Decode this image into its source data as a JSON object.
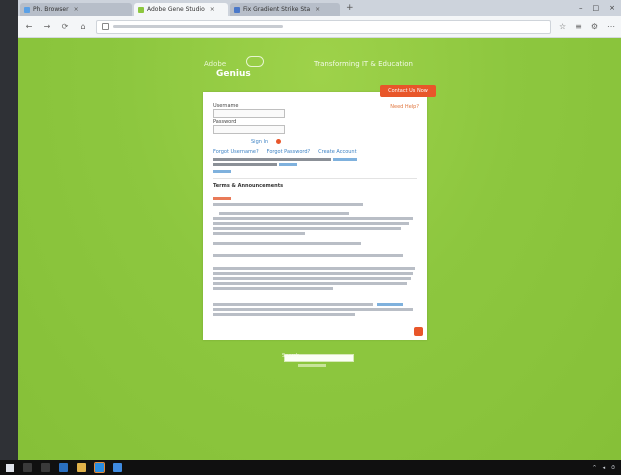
{
  "browser": {
    "tabs": [
      {
        "label": "Ph. Browser",
        "favicon_color": "#5aa0e6"
      },
      {
        "label": "Adobe Gene Studio",
        "favicon_color": "#8dc73f"
      },
      {
        "label": "Fix Gradient Strike Sta",
        "favicon_color": "#4a78c9"
      }
    ],
    "new_tab": "+",
    "window_controls": [
      "–",
      "□",
      "×"
    ],
    "nav": {
      "back": "←",
      "forward": "→",
      "reload": "⟳",
      "home": "⌂"
    },
    "toolbar_icons": [
      "☆",
      "≡",
      "⚙",
      "⋯"
    ]
  },
  "page": {
    "logo_line1": "Adobe",
    "logo_line2": "Genius",
    "tagline": "Transforming IT & Education",
    "card": {
      "report_button": "Contact Us Now",
      "help_link": "Need Help?",
      "username_label": "Username",
      "password_label": "Password",
      "signin_label": "Sign In",
      "links": [
        "Forgot Username?",
        "Forgot Password?",
        "Create Account"
      ],
      "section_title": "Terms & Announcements"
    },
    "search_label": "Search"
  },
  "colors": {
    "page_green": "#8dc73f",
    "accent_orange": "#e8562a",
    "link_blue": "#3d82c4"
  }
}
